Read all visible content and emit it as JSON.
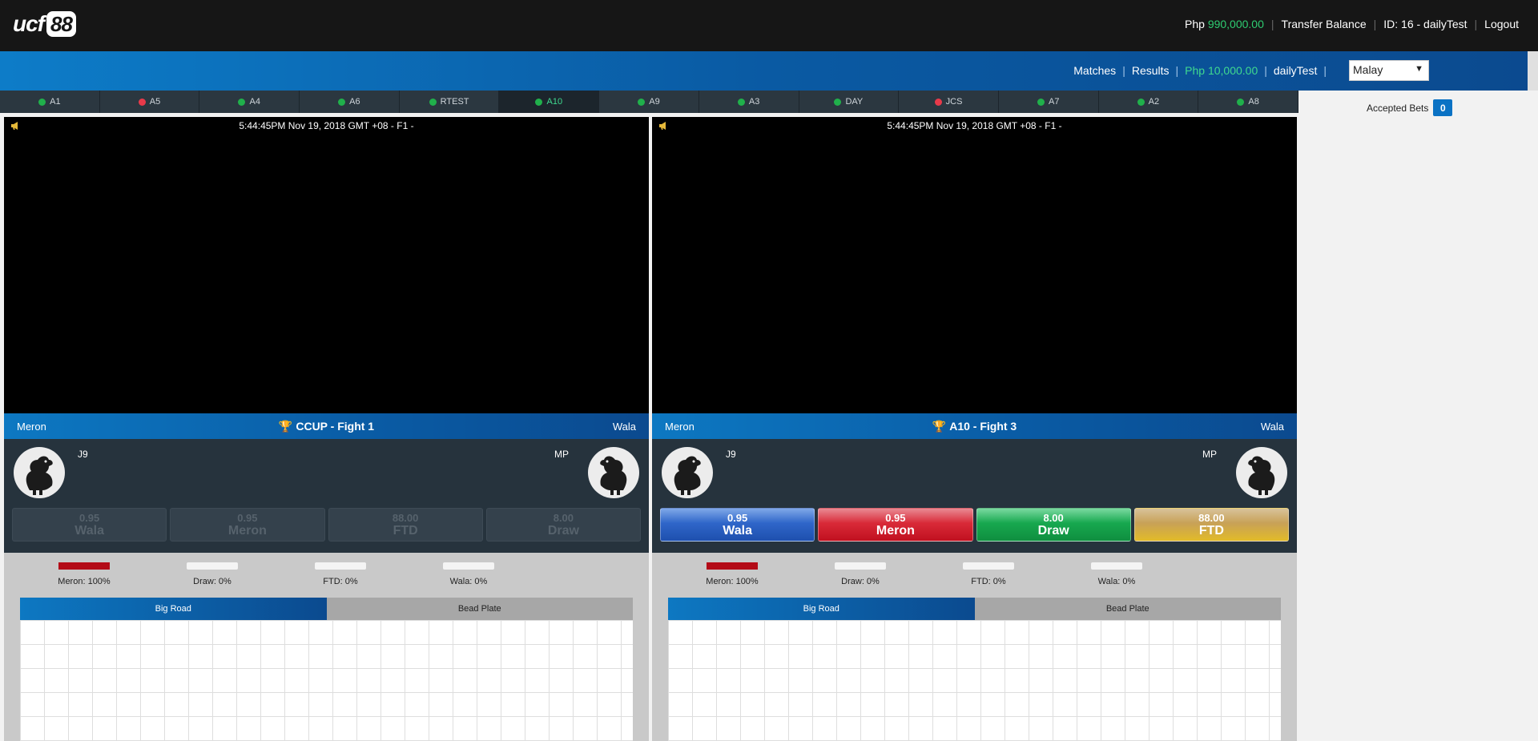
{
  "brand": {
    "logo_text": "ucf",
    "logo_num": "88"
  },
  "topnav": {
    "currency": "Php",
    "balance": "990,000.00",
    "transfer": "Transfer Balance",
    "user_id": "ID: 16 - dailyTest",
    "logout": "Logout"
  },
  "bluenav": {
    "matches": "Matches",
    "results": "Results",
    "credit": "Php 10,000.00",
    "username": "dailyTest",
    "language": "Malay"
  },
  "arenas": [
    {
      "label": "A1",
      "status": "green"
    },
    {
      "label": "A5",
      "status": "red"
    },
    {
      "label": "A4",
      "status": "green"
    },
    {
      "label": "A6",
      "status": "green"
    },
    {
      "label": "RTEST",
      "status": "green"
    },
    {
      "label": "A10",
      "status": "green",
      "active": true
    },
    {
      "label": "A9",
      "status": "green"
    },
    {
      "label": "A3",
      "status": "green"
    },
    {
      "label": "DAY",
      "status": "green"
    },
    {
      "label": "JCS",
      "status": "red"
    },
    {
      "label": "A7",
      "status": "green"
    },
    {
      "label": "A2",
      "status": "green"
    },
    {
      "label": "A8",
      "status": "green"
    }
  ],
  "accepted_bets": {
    "label": "Accepted Bets",
    "count": "0"
  },
  "panels": [
    {
      "timestamp": "5:44:45PM Nov 19, 2018 GMT +08 - F1 -",
      "left_label": "Meron",
      "right_label": "Wala",
      "fight_title": "CCUP - Fight 1",
      "left_fighter": "J9",
      "right_fighter": "MP",
      "bets_enabled": false,
      "bets": [
        {
          "odds": "0.95",
          "label": "Wala"
        },
        {
          "odds": "0.95",
          "label": "Meron"
        },
        {
          "odds": "88.00",
          "label": "FTD"
        },
        {
          "odds": "8.00",
          "label": "Draw"
        }
      ],
      "stats": [
        {
          "label": "Meron: 100%",
          "percent": 100
        },
        {
          "label": "Draw: 0%",
          "percent": 0
        },
        {
          "label": "FTD: 0%",
          "percent": 0
        },
        {
          "label": "Wala: 0%",
          "percent": 0
        }
      ],
      "tabs": {
        "active": "Big Road",
        "inactive": "Bead Plate"
      }
    },
    {
      "timestamp": "5:44:45PM Nov 19, 2018 GMT +08 - F1 -",
      "left_label": "Meron",
      "right_label": "Wala",
      "fight_title": "A10 - Fight 3",
      "left_fighter": "J9",
      "right_fighter": "MP",
      "bets_enabled": true,
      "bets": [
        {
          "odds": "0.95",
          "label": "Wala",
          "color": "#2f66c9"
        },
        {
          "odds": "0.95",
          "label": "Meron",
          "color": "#d92a38"
        },
        {
          "odds": "8.00",
          "label": "Draw",
          "color": "#17a84f"
        },
        {
          "odds": "88.00",
          "label": "FTD",
          "color": "#e2bb28"
        }
      ],
      "stats": [
        {
          "label": "Meron: 100%",
          "percent": 100
        },
        {
          "label": "Draw: 0%",
          "percent": 0
        },
        {
          "label": "FTD: 0%",
          "percent": 0
        },
        {
          "label": "Wala: 0%",
          "percent": 0
        }
      ],
      "tabs": {
        "active": "Big Road",
        "inactive": "Bead Plate"
      }
    }
  ]
}
